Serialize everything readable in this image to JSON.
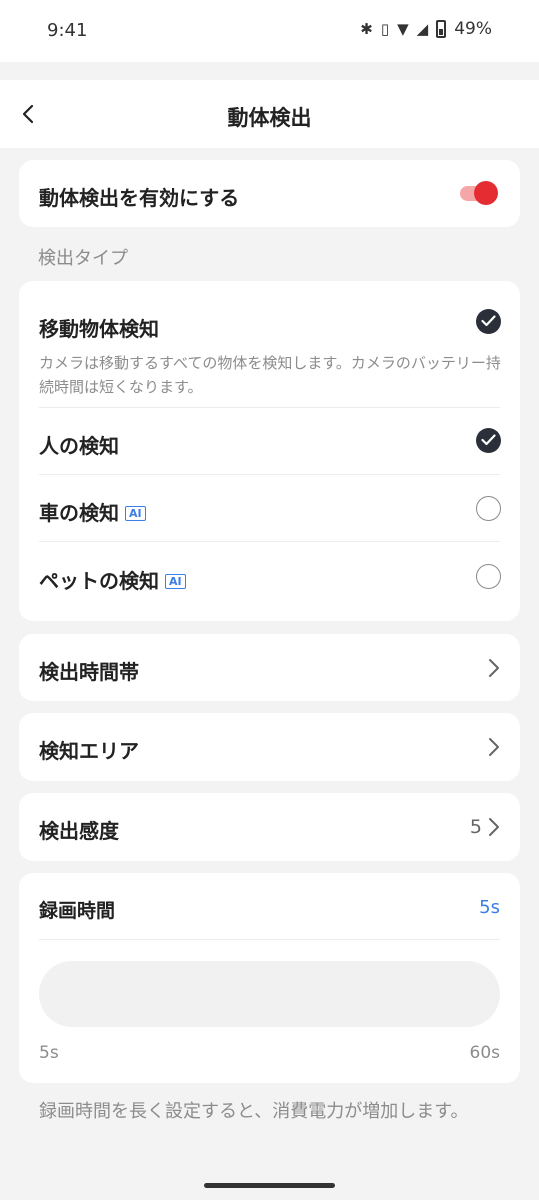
{
  "status": {
    "time": "9:41",
    "battery": "49%",
    "icons": [
      "bluetooth-icon",
      "vibrate-icon",
      "wifi-icon",
      "signal-icon",
      "battery-icon"
    ]
  },
  "nav": {
    "title": "動体検出",
    "back_icon": "chevron-left-icon"
  },
  "enable": {
    "label": "動体検出を有効にする",
    "on": true,
    "accent": "#e52c33"
  },
  "detection": {
    "section_label": "検出タイプ",
    "items": [
      {
        "label": "移動物体検知",
        "desc": "カメラは移動するすべての物体を検知します。カメラのバッテリー持続時間は短くなります。",
        "checked": true,
        "ai": false
      },
      {
        "label": "人の検知",
        "checked": true,
        "ai": false
      },
      {
        "label": "車の検知",
        "checked": false,
        "ai": true,
        "badge": "AI"
      },
      {
        "label": "ペットの検知",
        "checked": false,
        "ai": true,
        "badge": "AI"
      }
    ]
  },
  "settings": {
    "schedule": {
      "label": "検出時間帯"
    },
    "area": {
      "label": "検知エリア"
    },
    "sensitivity": {
      "label": "検出感度",
      "value": "5"
    }
  },
  "recording": {
    "label": "録画時間",
    "value": "5s",
    "min": "5s",
    "max": "60s",
    "value_color": "#3b7ee6"
  },
  "footnote": "録画時間を長く設定すると、消費電力が増加します。"
}
